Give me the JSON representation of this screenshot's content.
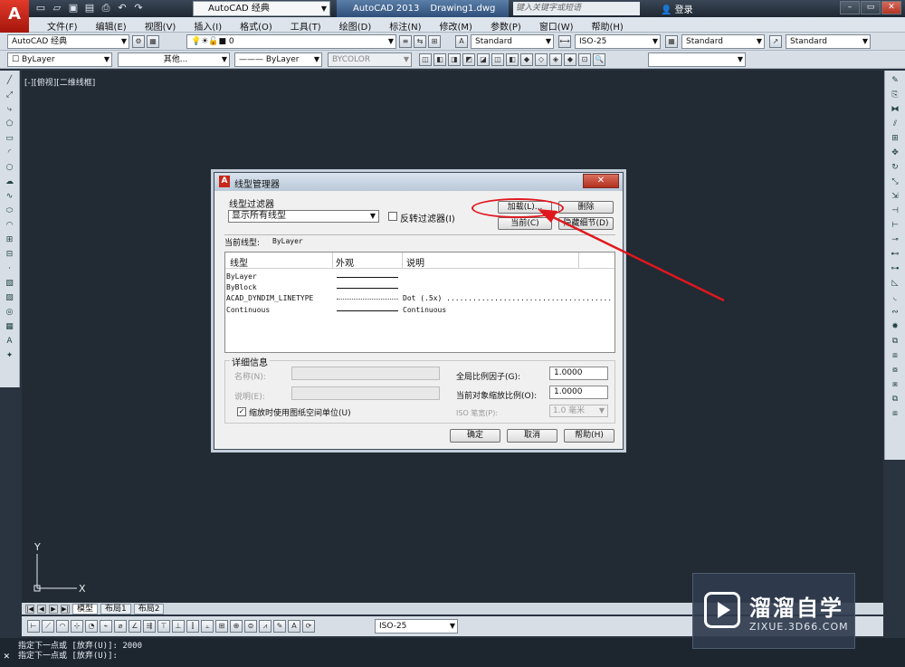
{
  "app": {
    "logo": "A",
    "workspace": "AutoCAD 经典",
    "title": "AutoCAD 2013",
    "document": "Drawing1.dwg",
    "search_placeholder": "键入关键字或短语",
    "login": "登录"
  },
  "menu": [
    "文件(F)",
    "编辑(E)",
    "视图(V)",
    "插入(I)",
    "格式(O)",
    "工具(T)",
    "绘图(D)",
    "标注(N)",
    "修改(M)",
    "参数(P)",
    "窗口(W)",
    "帮助(H)"
  ],
  "toolbar1": {
    "workspace_combo": "AutoCAD 经典",
    "layer_combo": "0",
    "text_style": "Standard",
    "dim_style": "ISO-25",
    "table_style": "Standard",
    "multileader_style": "Standard"
  },
  "toolbar2": {
    "color": "ByLayer",
    "linetype": "其他...",
    "lineweight": "ByLayer",
    "plotstyle": "BYCOLOR"
  },
  "view_label": "[-][俯视][二维线框]",
  "ucs": {
    "x": "X",
    "y": "Y"
  },
  "layout_tabs": [
    "模型",
    "布局1",
    "布局2"
  ],
  "dim_toolbar_style": "ISO-25",
  "command_lines": [
    "指定下一点或 [放弃(U)]: 2000",
    "指定下一点或 [放弃(U)]:"
  ],
  "watermark": {
    "brand": "溜溜自学",
    "url": "ZIXUE.3D66.COM"
  },
  "dialog": {
    "title": "线型管理器",
    "filter_label": "线型过滤器",
    "filter_value": "显示所有线型",
    "invert_filter": "反转过滤器(I)",
    "load_button": "加载(L)...",
    "delete_button": "删除",
    "current_button": "当前(C)",
    "hide_details_button": "隐藏细节(D)",
    "current_linetype_label": "当前线型:",
    "current_linetype_value": "ByLayer",
    "columns": [
      "线型",
      "外观",
      "说明"
    ],
    "rows": [
      {
        "name": "ByLayer",
        "desc": ""
      },
      {
        "name": "ByBlock",
        "desc": ""
      },
      {
        "name": "ACAD_DYNDIM_LINETYPE",
        "desc": "Dot (.5x) ......................................"
      },
      {
        "name": "Continuous",
        "desc": "Continuous"
      }
    ],
    "details_label": "详细信息",
    "name_label": "名称(N):",
    "desc_label": "说明(E):",
    "global_scale_label": "全局比例因子(G):",
    "global_scale_value": "1.0000",
    "object_scale_label": "当前对象缩放比例(O):",
    "object_scale_value": "1.0000",
    "iso_pen_label": "ISO 笔宽(P):",
    "iso_pen_value": "1.0 毫米",
    "paper_space_units": "缩放时使用图纸空间单位(U)",
    "ok": "确定",
    "cancel": "取消",
    "help": "帮助(H)"
  },
  "colors": {
    "annotation": "#e0171e",
    "drawing_bg": "#222a33"
  }
}
